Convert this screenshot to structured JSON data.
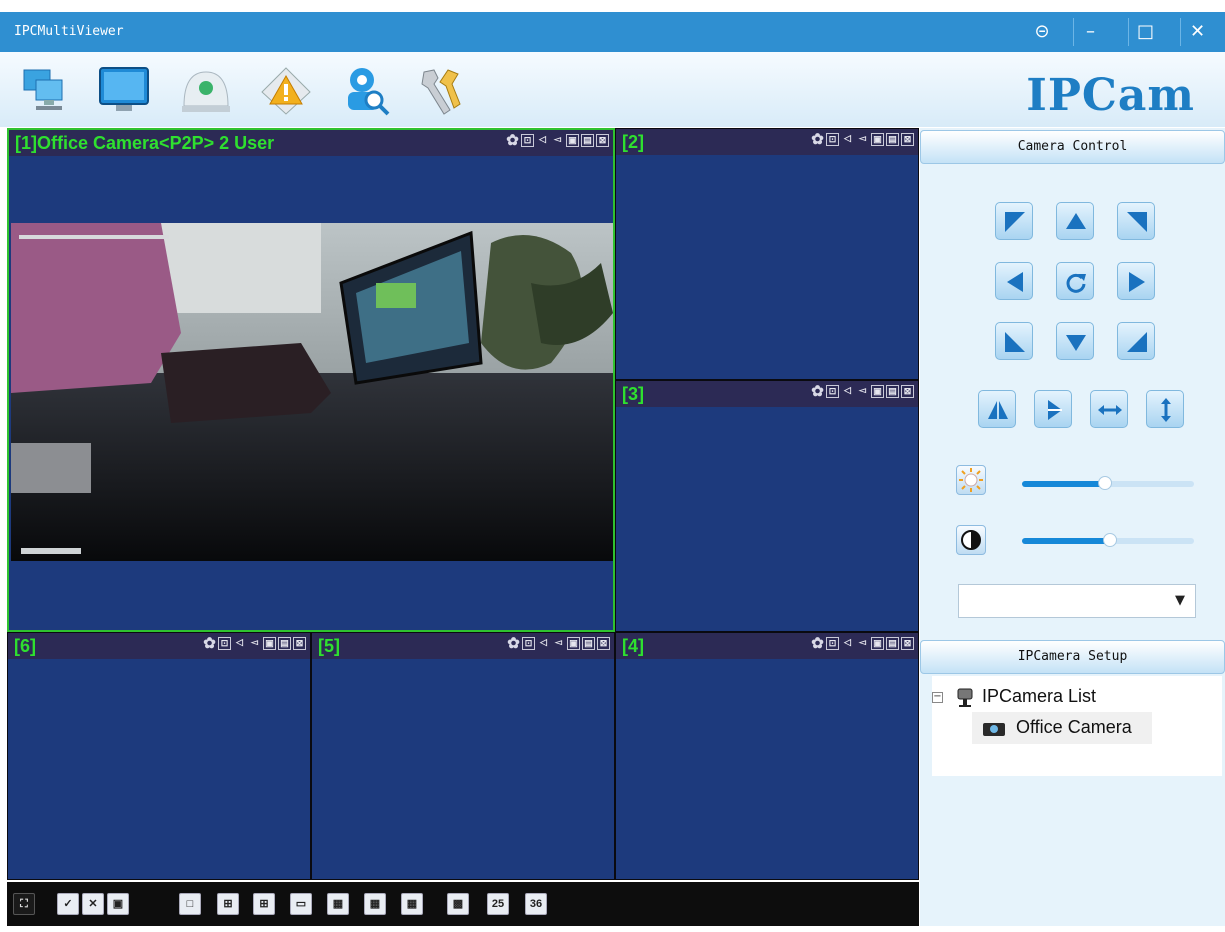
{
  "window": {
    "title": "IPCMultiViewer",
    "controls": {
      "menu": "⊝",
      "minimize": "–",
      "maximize": "□",
      "close": "✕"
    }
  },
  "toolbar": {
    "tools": [
      "camera-list-icon",
      "monitor-icon",
      "record-icon",
      "alarm-icon",
      "search-camera-icon",
      "settings-tools-icon"
    ],
    "brand": "IPCam"
  },
  "panes": [
    {
      "id": 1,
      "label": "[1]Office Camera<P2P> 2 User",
      "active": true
    },
    {
      "id": 2,
      "label": "[2]",
      "active": false
    },
    {
      "id": 3,
      "label": "[3]",
      "active": false
    },
    {
      "id": 4,
      "label": "[4]",
      "active": false
    },
    {
      "id": 5,
      "label": "[5]",
      "active": false
    },
    {
      "id": 6,
      "label": "[6]",
      "active": false
    }
  ],
  "layout_bar": {
    "buttons": [
      "fullscreen",
      "select-all",
      "close-all",
      "snapshot",
      "layout-1",
      "layout-4",
      "layout-6",
      "layout-8",
      "layout-9",
      "layout-10",
      "layout-13",
      "layout-16",
      "layout-25",
      "layout-36"
    ],
    "label_25": "25",
    "label_36": "36"
  },
  "camera_control": {
    "title": "Camera Control",
    "ptz": [
      "up-left",
      "up",
      "up-right",
      "left",
      "reset",
      "right",
      "down-left",
      "down",
      "down-right"
    ],
    "flips": [
      "flip-vertical",
      "mirror",
      "horizontal-patrol",
      "vertical-patrol"
    ],
    "brightness": 0.48,
    "contrast": 0.51,
    "preset_value": ""
  },
  "setup": {
    "title": "IPCamera Setup",
    "tree_root": "IPCamera List",
    "expander": "−",
    "cameras": [
      "Office Camera"
    ]
  },
  "colors": {
    "titlebar": "#2f8fd1",
    "pane_bg": "#1d3a7d",
    "active_border": "#2fc22f",
    "label_green": "#2fe02f",
    "brand": "#1e7ec4"
  }
}
